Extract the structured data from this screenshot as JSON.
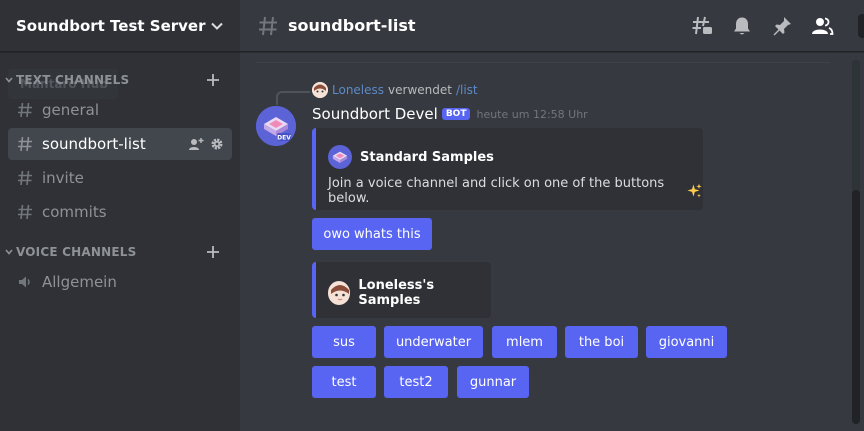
{
  "server": {
    "name": "Soundbort Test Server"
  },
  "tooltip": "Mantaro Hub",
  "categories": {
    "text": "TEXT CHANNELS",
    "voice": "VOICE CHANNELS"
  },
  "channels": {
    "general": "general",
    "soundbort_list": "soundbort-list",
    "invite": "invite",
    "commits": "commits",
    "allgemein": "Allgemein"
  },
  "header": {
    "channel": "soundbort-list"
  },
  "reply": {
    "user": "Loneless",
    "verb": "verwendet",
    "command": "/list"
  },
  "message": {
    "author": "Soundbort Devel",
    "tag": "BOT",
    "timestamp": "heute um 12:58 Uhr"
  },
  "embed1": {
    "title": "Standard Samples",
    "description": "Join a voice channel and click on one of the buttons below."
  },
  "embed1_button": "owo whats this",
  "embed2": {
    "title": "Loneless's Samples"
  },
  "sample_buttons": {
    "b0": "sus",
    "b1": "underwater",
    "b2": "mlem",
    "b3": "the boi",
    "b4": "giovanni",
    "b5": "test",
    "b6": "test2",
    "b7": "gunnar"
  },
  "colors": {
    "blurple": "#5865f2",
    "sidebar": "#2f3136",
    "main": "#36393f"
  }
}
